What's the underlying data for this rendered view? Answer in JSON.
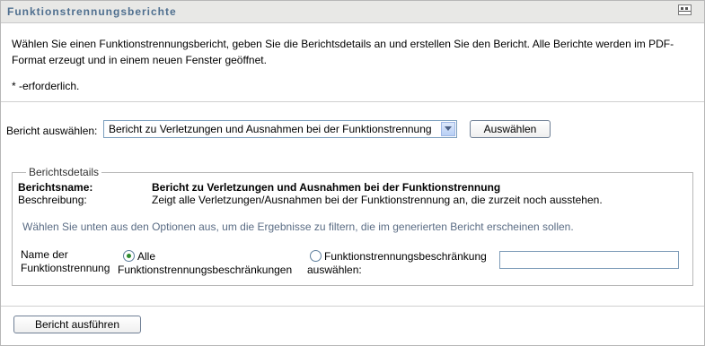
{
  "panel": {
    "title": "Funktionstrennungsberichte",
    "intro": "Wählen Sie einen Funktionstrennungsbericht, geben Sie die Berichtsdetails an und erstellen Sie den Bericht. Alle Berichte werden im PDF-Format erzeugt und in einem neuen Fenster geöffnet.",
    "required_note": "* -erforderlich."
  },
  "report": {
    "label": "Bericht auswählen:",
    "selected": "Bericht zu Verletzungen und Ausnahmen bei der Funktionstrennung",
    "button": "Auswählen"
  },
  "details": {
    "legend": "Berichtsdetails",
    "name_label": "Berichtsname:",
    "name_value": "Bericht zu Verletzungen und Ausnahmen bei der Funktionstrennung",
    "desc_label": "Beschreibung:",
    "desc_value": "Zeigt alle Verletzungen/Ausnahmen bei der Funktionstrennung an, die zurzeit noch ausstehen.",
    "hint": "Wählen Sie unten aus den Optionen aus, um die Ergebnisse zu filtern, die im generierten Bericht erscheinen sollen.",
    "field_label_line1": "Name der",
    "field_label_line2": "Funktionstrennung",
    "option_all_line1": "Alle",
    "option_all_line2": "Funktionstrennungsbeschränkungen",
    "option_select_line1": "Funktionstrennungsbeschränkung",
    "option_select_line2": "auswählen:",
    "selected_option": "all",
    "input_value": ""
  },
  "actions": {
    "run_button": "Bericht ausführen"
  },
  "colors": {
    "header_bg": "#e8e8e6",
    "header_text": "#4f6f8f",
    "hint_text": "#5a6c84",
    "radio_checked": "#2e8b2e"
  }
}
